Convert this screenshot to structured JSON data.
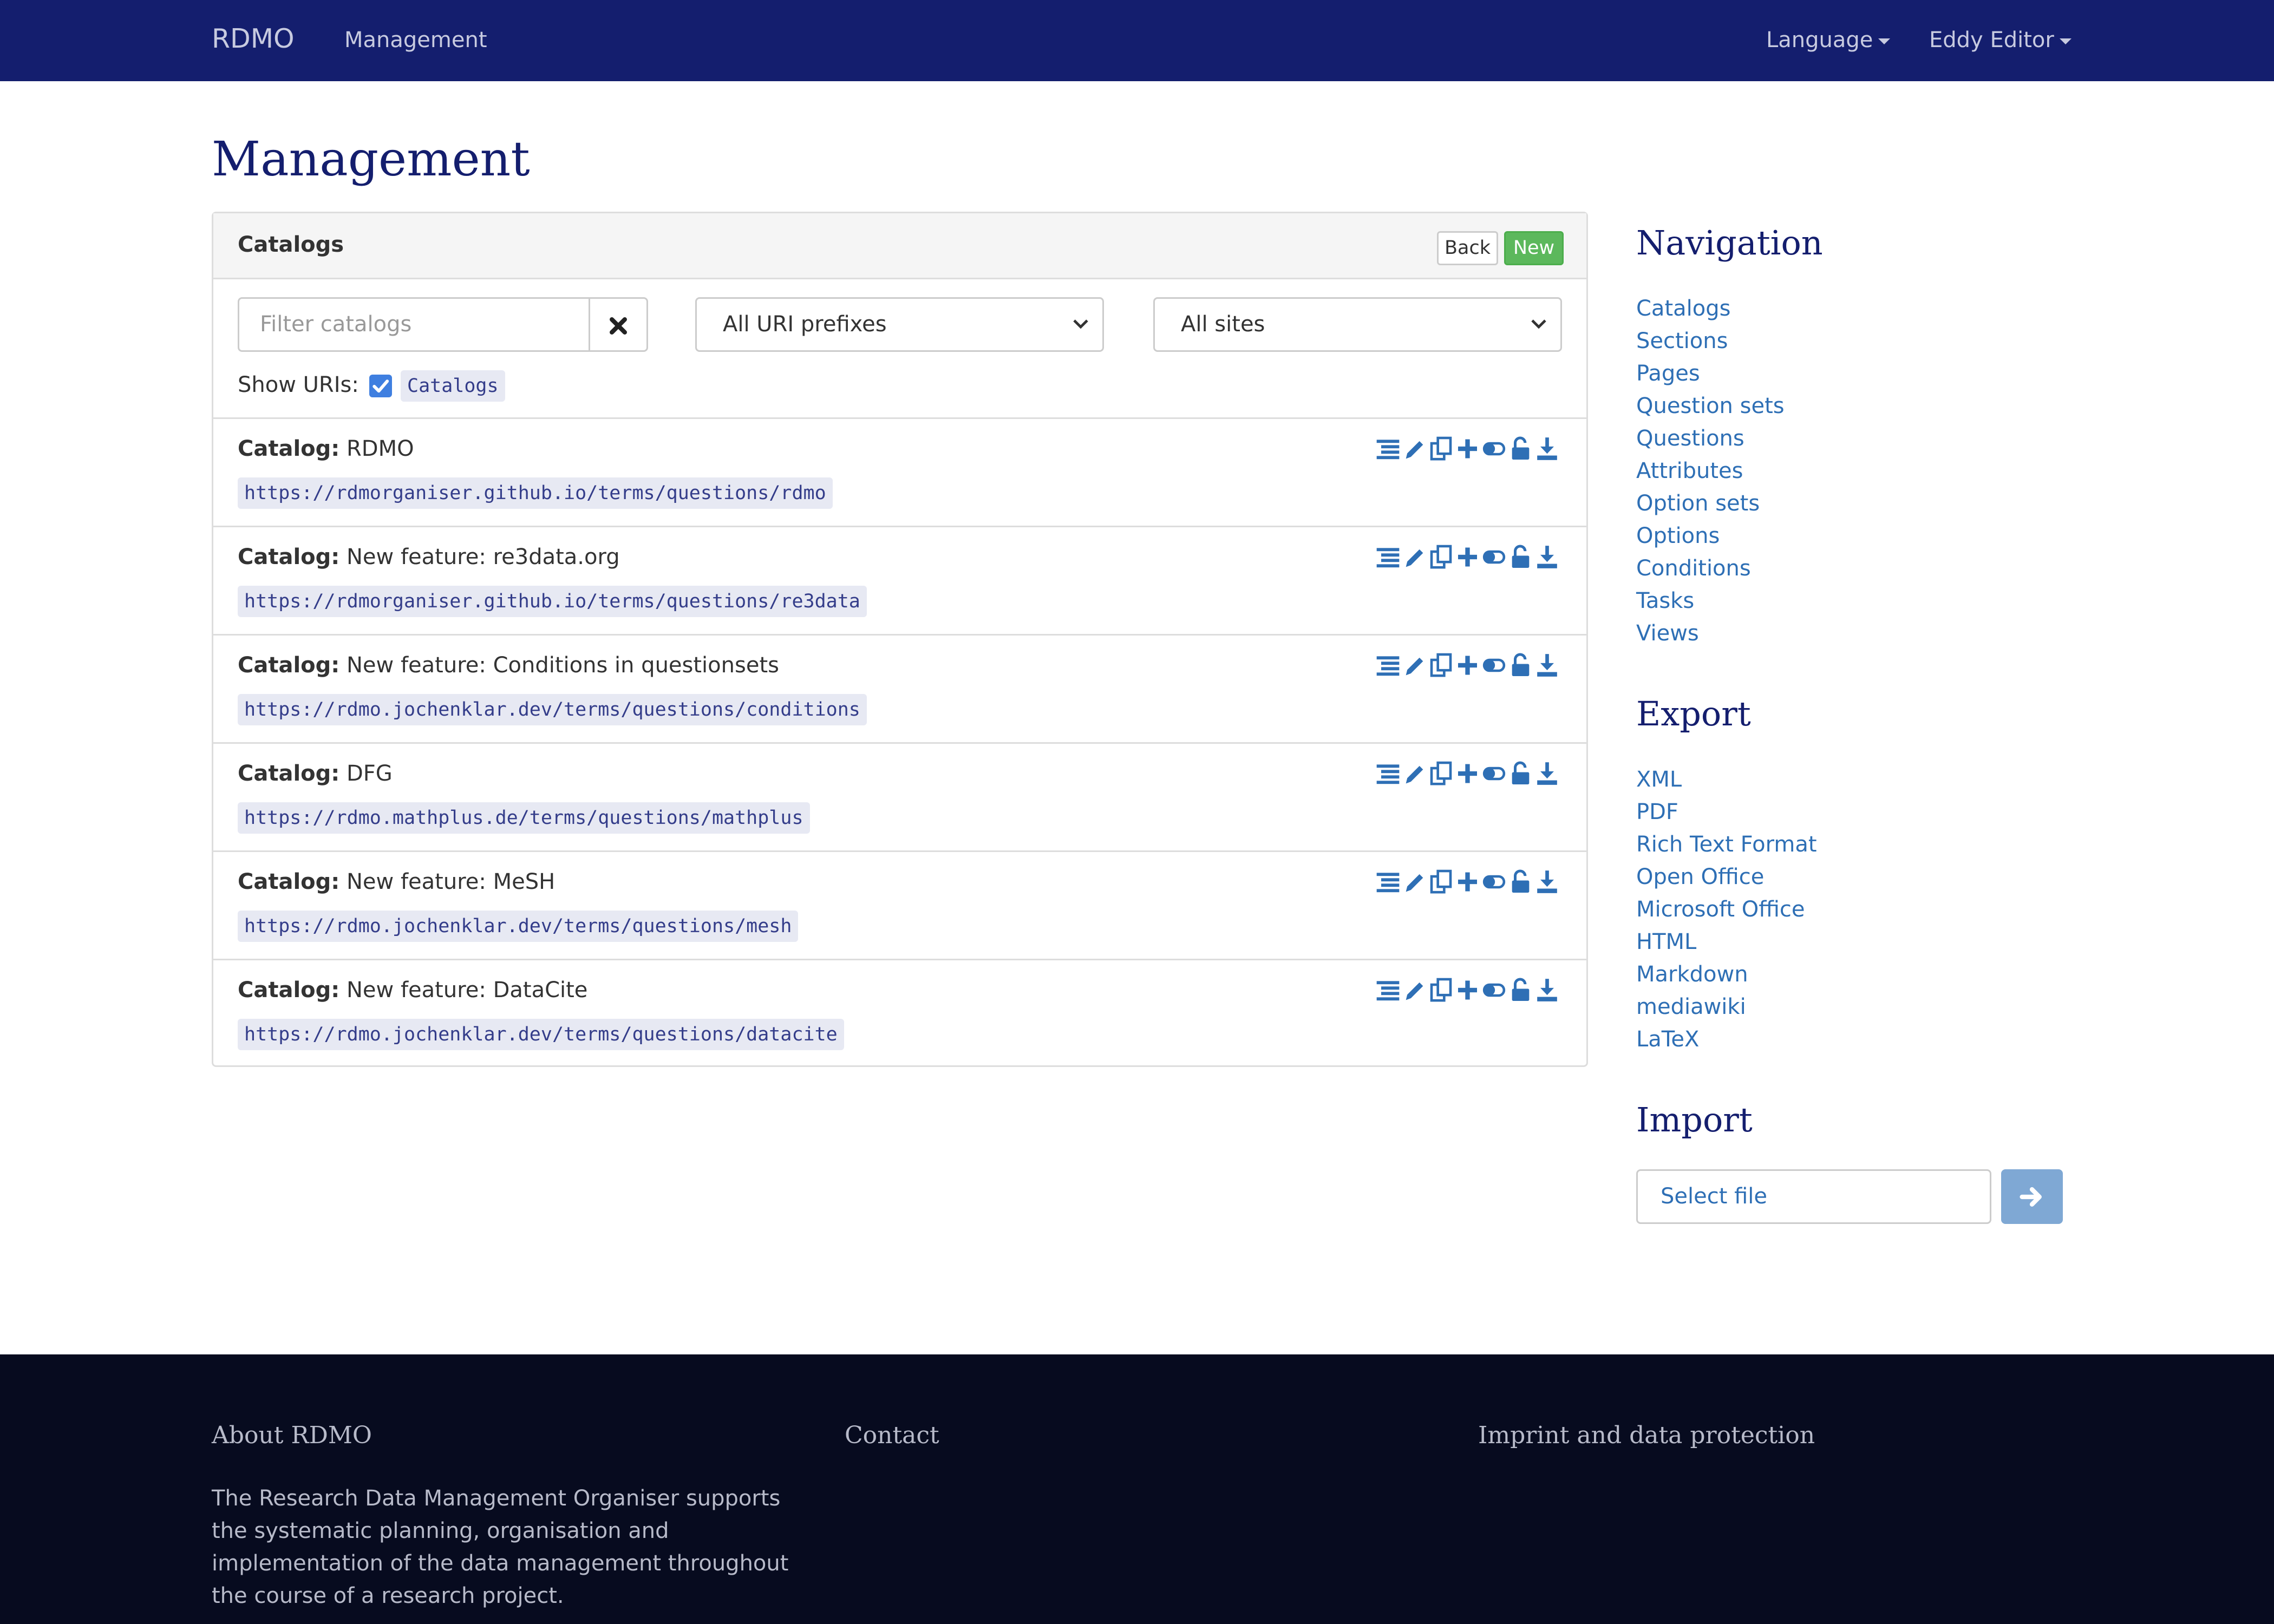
{
  "navbar": {
    "brand": "RDMO",
    "management_link": "Management",
    "language_menu": "Language",
    "user_menu": "Eddy Editor"
  },
  "page": {
    "title": "Management"
  },
  "catalogs_panel": {
    "title": "Catalogs",
    "back_label": "Back",
    "new_label": "New",
    "filter_placeholder": "Filter catalogs",
    "clear_icon": "times-icon",
    "uri_prefix_select": "All URI prefixes",
    "sites_select": "All sites",
    "show_uris_label": "Show URIs:",
    "show_uris_checked": true,
    "uri_tag": "Catalogs",
    "item_label_prefix": "Catalog:",
    "item_action_icons": [
      "list-icon",
      "pencil-icon",
      "copy-icon",
      "plus-icon",
      "toggle-icon",
      "unlock-icon",
      "download-icon"
    ],
    "items": [
      {
        "name": "RDMO",
        "uri": "https://rdmorganiser.github.io/terms/questions/rdmo"
      },
      {
        "name": "New feature: re3data.org",
        "uri": "https://rdmorganiser.github.io/terms/questions/re3data"
      },
      {
        "name": "New feature: Conditions in questionsets",
        "uri": "https://rdmo.jochenklar.dev/terms/questions/conditions"
      },
      {
        "name": "DFG",
        "uri": "https://rdmo.mathplus.de/terms/questions/mathplus"
      },
      {
        "name": "New feature: MeSH",
        "uri": "https://rdmo.jochenklar.dev/terms/questions/mesh"
      },
      {
        "name": "New feature: DataCite",
        "uri": "https://rdmo.jochenklar.dev/terms/questions/datacite"
      }
    ]
  },
  "sidebar": {
    "navigation_heading": "Navigation",
    "navigation": [
      "Catalogs",
      "Sections",
      "Pages",
      "Question sets",
      "Questions",
      "Attributes",
      "Option sets",
      "Options",
      "Conditions",
      "Tasks",
      "Views"
    ],
    "export_heading": "Export",
    "export": [
      "XML",
      "PDF",
      "Rich Text Format",
      "Open Office",
      "Microsoft Office",
      "HTML",
      "Markdown",
      "mediawiki",
      "LaTeX"
    ],
    "import_heading": "Import",
    "import_file_label": "Select file",
    "import_button_icon": "arrow-right-icon"
  },
  "footer": {
    "about_heading": "About RDMO",
    "contact_heading": "Contact",
    "imprint_heading": "Imprint and data protection",
    "about_text": "The Research Data Management Organiser supports the systematic planning, organisation and implementation of the data management throughout the course of a research project."
  },
  "colors": {
    "navbar_bg": "#141e6e",
    "link": "#2e6fb5",
    "new_button": "#5cb85c",
    "footer_bg": "#070b1f"
  }
}
